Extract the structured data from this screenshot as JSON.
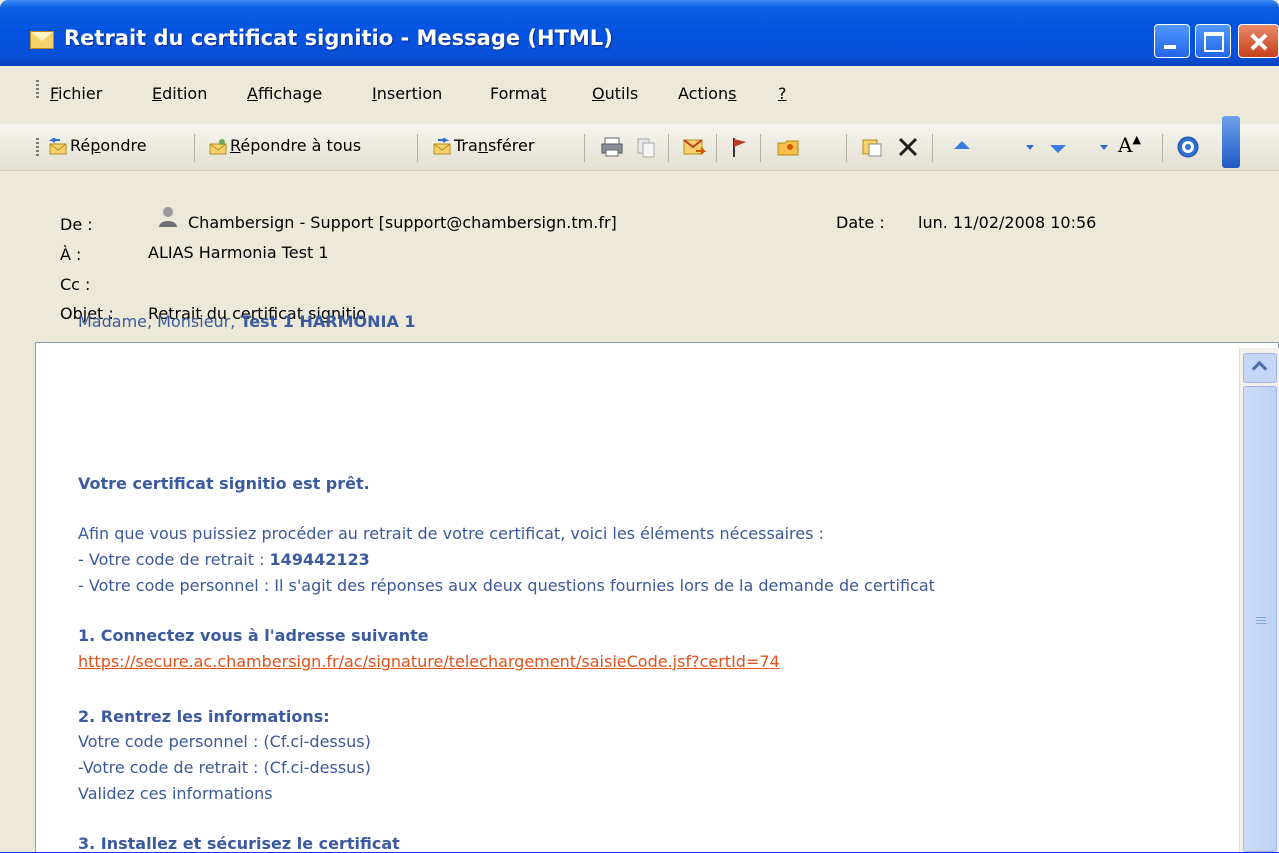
{
  "window": {
    "title": "Retrait du certificat signitio - Message (HTML)"
  },
  "menu": {
    "items": [
      {
        "pre": "",
        "acc": "F",
        "post": "ichier"
      },
      {
        "pre": "",
        "acc": "E",
        "post": "dition"
      },
      {
        "pre": "",
        "acc": "A",
        "post": "ffichage"
      },
      {
        "pre": "",
        "acc": "I",
        "post": "nsertion"
      },
      {
        "pre": "Forma",
        "acc": "t",
        "post": ""
      },
      {
        "pre": "",
        "acc": "O",
        "post": "utils"
      },
      {
        "pre": "Action",
        "acc": "s",
        "post": ""
      },
      {
        "pre": "",
        "acc": "?",
        "post": ""
      }
    ]
  },
  "toolbar": {
    "reply": {
      "pre": "Ré",
      "acc": "p",
      "post": "ondre"
    },
    "reply_all": {
      "pre": "",
      "acc": "R",
      "post": "épondre à tous"
    },
    "forward": {
      "pre": "Tra",
      "acc": "n",
      "post": "sférer"
    },
    "font_size_label": "A"
  },
  "header": {
    "from_label": "De :",
    "from_value": "Chambersign - Support [support@chambersign.tm.fr]",
    "date_label": "Date :",
    "date_value": "lun. 11/02/2008 10:56",
    "to_label": "À :",
    "to_value": "ALIAS Harmonia Test 1",
    "cc_label": "Cc :",
    "cc_value": "",
    "subject_label": "Objet :",
    "subject_value": "Retrait du certificat signitio"
  },
  "body": {
    "greeting": "Madame, Monsieur, ",
    "greeting_name": "Test 1 HARMONIA 1",
    "ready": "Votre certificat signitio est prêt.",
    "intro": "Afin que vous puissiez procéder au retrait de votre certificat, voici les éléments nécessaires :",
    "code_retrait_label": "- Votre code de retrait : ",
    "code_retrait_value": "149442123",
    "code_personnel": "- Votre code personnel : Il s'agit des réponses aux deux questions fournies lors de la demande de certificat",
    "step1": "1. Connectez vous à l'adresse suivante",
    "link": "https://secure.ac.chambersign.fr/ac/signature/telechargement/saisieCode.jsf?certId=74",
    "step2": "2. Rentrez les informations:",
    "step2_line1": "Votre code personnel : (Cf.ci-dessus)",
    "step2_line2": "-Votre code de retrait : (Cf.ci-dessus)",
    "step2_line3": "Validez ces informations",
    "step3": "3. Installez et sécurisez le certificat"
  },
  "colors": {
    "body_text": "#3b5998",
    "link": "#e3501a",
    "titlebar": "#0453e0"
  }
}
